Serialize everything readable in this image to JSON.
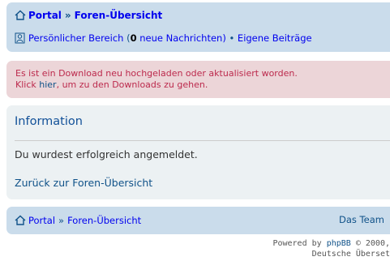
{
  "top_nav": {
    "portal": "Portal",
    "separator": "»",
    "forum_index": "Foren-Übersicht",
    "private_area": "Persönlicher Bereich",
    "new_messages_open": "(",
    "new_messages_count": "0",
    "new_messages_label": "neue Nachrichten)",
    "bullet": "•",
    "own_posts": "Eigene Beiträge"
  },
  "alert": {
    "line1": "Es ist ein Download neu hochgeladen oder aktualisiert worden.",
    "line2_prefix": "Klick",
    "line2_link": "hier",
    "line2_suffix": ", um zu den Downloads zu gehen."
  },
  "panel": {
    "title": "Information",
    "message": "Du wurdest erfolgreich angemeldet.",
    "back_link": "Zurück zur Foren-Übersicht"
  },
  "bottom_nav": {
    "portal": "Portal",
    "separator": "»",
    "forum_index": "Foren-Übersicht",
    "team": "Das Team"
  },
  "footer": {
    "powered_prefix": "Powered by",
    "phpbb": "phpBB",
    "powered_suffix": "© 2000,",
    "line2": "Deutsche Überset"
  },
  "colors": {
    "navbar_bg": "#cadceb",
    "alert_bg": "#ecd5d8",
    "alert_text": "#bc2a4d",
    "panel_bg": "#ecf1f3",
    "link": "#105289"
  },
  "icons": {
    "home": "home-icon",
    "user": "user-icon"
  }
}
